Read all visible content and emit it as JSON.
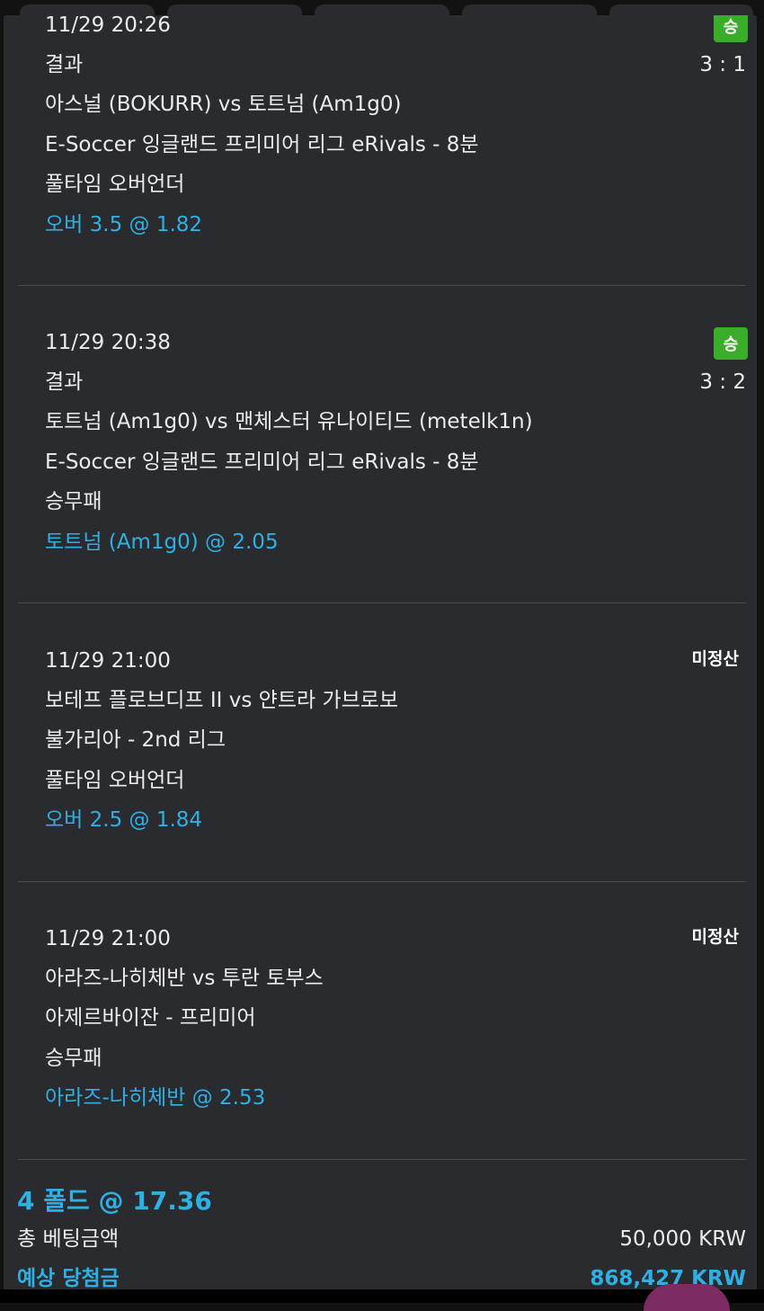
{
  "bets": [
    {
      "datetime": "11/29 20:26",
      "status": "승",
      "market_label": "결과",
      "score": "3 : 1",
      "match": "아스널 (BOKURR) vs 토트넘 (Am1g0)",
      "league": "E-Soccer 잉글랜드 프리미어 리그 eRivals - 8분",
      "bet_type": "풀타임 오버언더",
      "pick": "오버 3.5 @ 1.82"
    },
    {
      "datetime": "11/29 20:38",
      "status": "승",
      "market_label": "결과",
      "score": "3 : 2",
      "match": "토트넘 (Am1g0) vs 맨체스터 유나이티드 (metelk1n)",
      "league": "E-Soccer 잉글랜드 프리미어 리그 eRivals - 8분",
      "bet_type": "승무패",
      "pick": "토트넘 (Am1g0) @ 2.05"
    },
    {
      "datetime": "11/29 21:00",
      "status": "미정산",
      "match": "보테프 플로브디프 II vs 얀트라 가브로보",
      "league": "불가리아 - 2nd 리그",
      "bet_type": "풀타임 오버언더",
      "pick": "오버 2.5 @ 1.84"
    },
    {
      "datetime": "11/29 21:00",
      "status": "미정산",
      "match": "아라즈-나히체반 vs 투란 토부스",
      "league": "아제르바이잔 - 프리미어",
      "bet_type": "승무패",
      "pick": "아라즈-나히체반 @ 2.53"
    }
  ],
  "summary": {
    "title": "4 폴드 @ 17.36",
    "total_label": "총 베팅금액",
    "total_value": "50,000 KRW",
    "expected_label": "예상 당첨금",
    "expected_value": "868,427 KRW"
  },
  "colors": {
    "background": "#121212",
    "card": "#2a2b2f",
    "accent_blue": "#2fb0e4",
    "win_green": "#3aae2a",
    "divider": "#4a4b50"
  }
}
